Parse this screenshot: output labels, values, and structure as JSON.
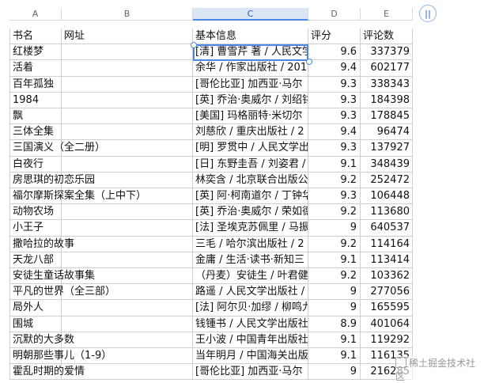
{
  "columns": [
    "A",
    "B",
    "C",
    "D",
    "E"
  ],
  "selected_column": "C",
  "headers": [
    "书名",
    "网址",
    "基本信息",
    "评分",
    "评论数"
  ],
  "rows": [
    [
      "红楼梦",
      "",
      "[清] 曹雪芹 著 / 人民文学",
      "9.6",
      "337379"
    ],
    [
      "活着",
      "",
      "余华 / 作家出版社 / 201",
      "9.4",
      "602177"
    ],
    [
      "百年孤独",
      "",
      "[哥伦比亚] 加西亚·马尔",
      "9.3",
      "338343"
    ],
    [
      "1984",
      "",
      "[英] 乔治·奥威尔 / 刘绍铭",
      "9.3",
      "184398"
    ],
    [
      "飘",
      "",
      "[美国] 玛格丽特·米切尔",
      "9.3",
      "178845"
    ],
    [
      "三体全集",
      "",
      "刘慈欣 / 重庆出版社 / 2",
      "9.4",
      "96474"
    ],
    [
      "三国演义（全二册）",
      "",
      "[明] 罗贯中 / 人民文学出",
      "9.3",
      "137927"
    ],
    [
      "白夜行",
      "",
      "[日] 东野圭吾 / 刘姿君 /",
      "9.1",
      "348439"
    ],
    [
      "房思琪的初恋乐园",
      "",
      "林奕含 / 北京联合出版公",
      "9.2",
      "252472"
    ],
    [
      "福尔摩斯探案全集（上中下）",
      "",
      "[英] 阿·柯南道尔 / 丁钟华",
      "9.3",
      "106448"
    ],
    [
      "动物农场",
      "",
      "[英] 乔治·奥威尔 / 荣如德",
      "9.2",
      "113680"
    ],
    [
      "小王子",
      "",
      "[法] 圣埃克苏佩里 / 马振",
      "9",
      "640537"
    ],
    [
      "撒哈拉的故事",
      "",
      "三毛 / 哈尔滨出版社 / 2",
      "9.2",
      "114164"
    ],
    [
      "天龙八部",
      "",
      "金庸 / 生活·读书·新知三",
      "9.1",
      "113414"
    ],
    [
      "安徒生童话故事集",
      "",
      "（丹麦）安徒生 / 叶君健",
      "9.2",
      "103362"
    ],
    [
      "平凡的世界（全三部）",
      "",
      "路遥 / 人民文学出版社 /",
      "9",
      "277056"
    ],
    [
      "局外人",
      "",
      "[法] 阿尔贝·加缪 / 柳鸣九",
      "9",
      "165595"
    ],
    [
      "围城",
      "",
      "钱锺书 / 人民文学出版社",
      "8.9",
      "401064"
    ],
    [
      "沉默的大多数",
      "",
      "王小波 / 中国青年出版社",
      "9.1",
      "119292"
    ],
    [
      "明朝那些事儿（1-9）",
      "",
      "当年明月 / 中国海关出版社",
      "9.1",
      "116135"
    ],
    [
      "霍乱时期的爱情",
      "",
      "[哥伦比亚] 加西亚·马尔",
      "9",
      "216285"
    ]
  ],
  "watermark": "稀土掘金技术社区"
}
